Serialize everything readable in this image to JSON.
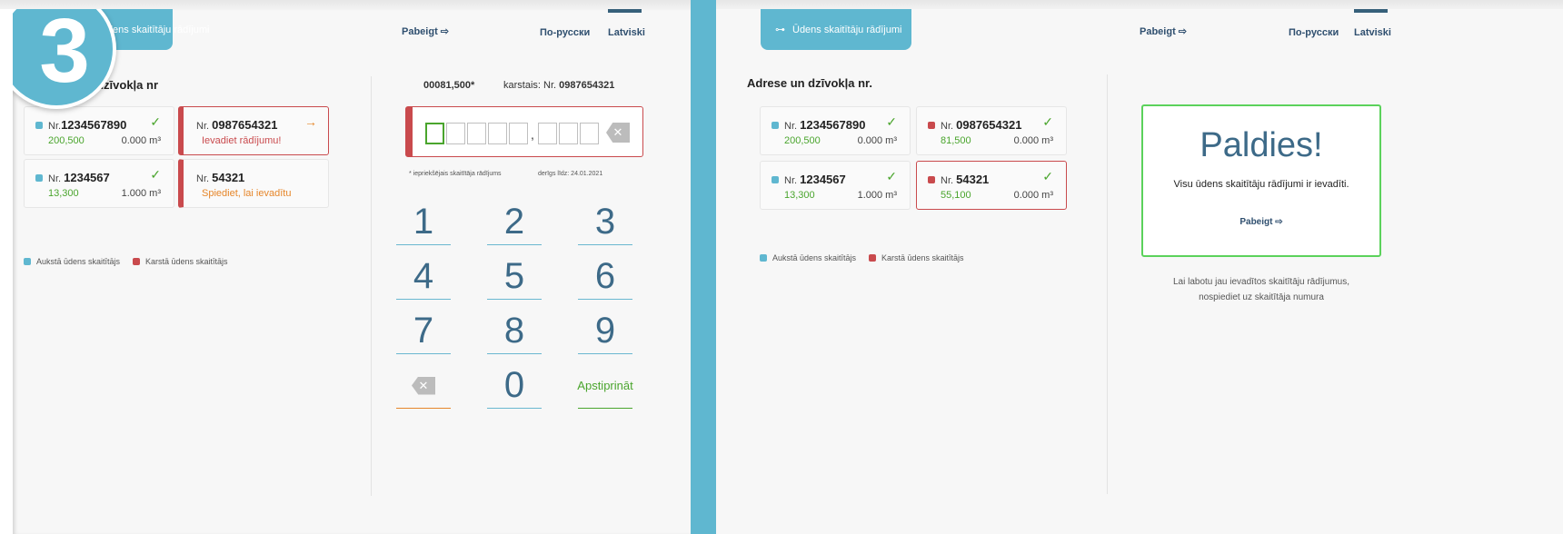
{
  "step_number": "3",
  "colors": {
    "accent": "#5fb7d0",
    "cold": "#5fb7d0",
    "hot": "#c94a4d",
    "ok": "#4aa52d",
    "warn": "#e6862a",
    "dark": "#3d6a88"
  },
  "left": {
    "tab_title": "Ūdens skaitītāju rādījumi",
    "finish": "Pabeigt",
    "lang_ru": "По-русски",
    "lang_lv": "Latviski",
    "section_title": "Adrese un dzīvokļa nr.",
    "cards": [
      {
        "prefix": "Nr.",
        "number": "1234567890",
        "value": "200,500",
        "consumption": "0.000 m³"
      },
      {
        "prefix": "Nr.",
        "number": "0987654321",
        "message": "Ievadiet rādījumu!"
      },
      {
        "prefix": "Nr.",
        "number": "1234567",
        "value": "13,300",
        "consumption": "1.000 m³"
      },
      {
        "prefix": "Nr.",
        "number": "54321",
        "message": "Spiediet, lai ievadītu"
      }
    ],
    "legend_cold": "Aukstā ūdens skaitītājs",
    "legend_hot": "Karstā ūdens skaitītājs",
    "reading_prev": "00081,500*",
    "reading_meter_label": "karstais: Nr.",
    "reading_meter_number": "0987654321",
    "note_prev": "* iepriekšējais skaitītāja rādījums",
    "note_valid": "derīgs līdz: 24.01.2021",
    "keys": [
      "1",
      "2",
      "3",
      "4",
      "5",
      "6",
      "7",
      "8",
      "9",
      "0"
    ],
    "confirm": "Apstiprināt"
  },
  "right": {
    "tab_title": "Ūdens skaitītāju rādījumi",
    "finish": "Pabeigt",
    "lang_ru": "По-русски",
    "lang_lv": "Latviski",
    "section_title": "Adrese un dzīvokļa nr.",
    "cards": [
      {
        "prefix": "Nr.",
        "number": "1234567890",
        "value": "200,500",
        "consumption": "0.000 m³"
      },
      {
        "prefix": "Nr.",
        "number": "0987654321",
        "value": "81,500",
        "consumption": "0.000 m³"
      },
      {
        "prefix": "Nr.",
        "number": "1234567",
        "value": "13,300",
        "consumption": "1.000 m³"
      },
      {
        "prefix": "Nr.",
        "number": "54321",
        "value": "55,100",
        "consumption": "0.000 m³"
      }
    ],
    "legend_cold": "Aukstā ūdens skaitītājs",
    "legend_hot": "Karstā ūdens skaitītājs",
    "thanks_title": "Paldies!",
    "thanks_sub": "Visu ūdens skaitītāju rādījumi ir ievadīti.",
    "thanks_finish": "Pabeigt",
    "help_line1": "Lai labotu jau ievadītos skaitītāju rādījumus,",
    "help_line2": "nospiediet uz skaitītāja numura"
  }
}
